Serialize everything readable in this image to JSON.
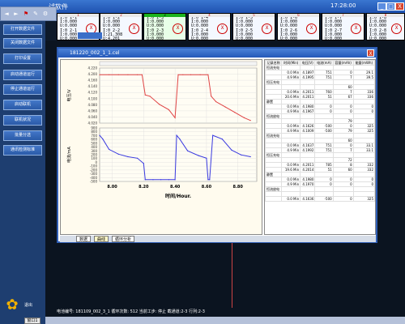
{
  "app": {
    "title": "试软件",
    "clock": "17:28:00"
  },
  "window_buttons": [
    "_",
    "□",
    "X"
  ],
  "toolbar": {
    "icons": [
      "◄",
      "►",
      "⚑",
      "✎",
      "⚙"
    ]
  },
  "channels": [
    {
      "num": "1",
      "lines": [
        "I:0 1-1",
        "I:0.000",
        "U:0.000",
        "T:0.000"
      ]
    },
    {
      "num": "2",
      "lines": [
        "I:0 1-2",
        "I:0.000",
        "U:0.000",
        "T:0.000"
      ]
    },
    {
      "num": "3",
      "lines": [
        "I:0 1-3",
        "I:0.000",
        "U:0.000",
        "T:0.000"
      ]
    },
    {
      "num": "4",
      "lines": [
        "I:0 1-4",
        "I:0.000",
        "U:0.000",
        "T:0.000"
      ]
    },
    {
      "num": "5",
      "lines": [
        "I:0 1-5",
        "I:0.000",
        "U:0.000",
        "T:0.000"
      ]
    },
    {
      "num": "6",
      "lines": [
        "I:0 1-6",
        "I:0.000",
        "U:0.000",
        "T:0.000"
      ]
    },
    {
      "num": "7",
      "lines": [
        "I:0 1-7",
        "I:0.000",
        "U:0.000",
        "T:0.000"
      ]
    },
    {
      "num": "8",
      "lines": [
        "I:0 1-8",
        "I:0.000",
        "U:0.000",
        "T:0.000"
      ]
    }
  ],
  "channels_row2": [
    {
      "lines": [
        "I:0 2-1",
        "I:0.000",
        "U:0.000",
        "T:0.000"
      ]
    },
    {
      "lines": [
        "I:0 2-2",
        "I:21.308",
        "U:4.201",
        "T:0.000"
      ]
    },
    {
      "lines": [
        "I:0 2-3",
        "I:0.000",
        "U:0.000",
        "T:0.000"
      ]
    },
    {
      "lines": [
        "I:0 2-4",
        "I:0.000",
        "U:0.000",
        "T:0.000"
      ]
    },
    {
      "lines": [
        "I:0 2-5",
        "I:0.000",
        "U:0.000",
        "T:0.000"
      ]
    },
    {
      "lines": [
        "I:0 2-6",
        "I:0.000",
        "U:0.000",
        "T:0.000"
      ]
    },
    {
      "lines": [
        "I:0 2-7",
        "I:0.000",
        "U:0.000",
        "T:0.000"
      ]
    },
    {
      "lines": [
        "I:0 2-8",
        "I:0.000",
        "U:0.000",
        "T:0.000"
      ]
    }
  ],
  "sidebar": {
    "items": [
      "打开数据文件",
      "关闭数据文件",
      "打印设置",
      "启动通道运行",
      "停止通道运行",
      "启动联机",
      "联机状况",
      "批量分选",
      "通讯检测标准"
    ],
    "exit_label": "退出"
  },
  "dialog": {
    "title": "181220_002_1_1.cel",
    "close": "X"
  },
  "chart_data": [
    {
      "type": "line",
      "title": "",
      "xlabel": "",
      "ylabel": "电压/V",
      "x": [
        7.92,
        7.98,
        8.04,
        8.1,
        8.16,
        8.19,
        8.21,
        8.24,
        8.3,
        8.36,
        8.4,
        8.42,
        8.45,
        8.5,
        8.56,
        8.61,
        8.63,
        8.66,
        8.72,
        8.78,
        8.84,
        8.88
      ],
      "values": [
        4.2,
        4.2,
        4.2,
        4.2,
        4.2,
        4.2,
        4.125,
        4.12,
        4.09,
        4.07,
        4.04,
        4.2,
        4.2,
        4.2,
        4.2,
        4.2,
        4.12,
        4.1,
        4.08,
        4.06,
        4.04,
        4.03
      ],
      "ylim": [
        4.02,
        4.225
      ],
      "yticks": [
        "4.220",
        "4.200",
        "4.160",
        "4.140",
        "4.120",
        "4.100",
        "4.080",
        "4.060",
        "4.040",
        "4.020"
      ],
      "grid": true
    },
    {
      "type": "line",
      "title": "",
      "xlabel": "时间/Hour.",
      "ylabel": "电流/mA",
      "x": [
        7.92,
        7.94,
        7.98,
        8.04,
        8.1,
        8.16,
        8.2,
        8.21,
        8.26,
        8.31,
        8.36,
        8.4,
        8.41,
        8.43,
        8.48,
        8.55,
        8.6,
        8.61,
        8.62,
        8.64,
        8.7,
        8.76,
        8.82,
        8.88
      ],
      "values": [
        700,
        600,
        320,
        190,
        120,
        80,
        -60,
        -500,
        -500,
        -500,
        -500,
        -500,
        700,
        600,
        280,
        150,
        80,
        -500,
        -500,
        700,
        600,
        300,
        170,
        120
      ],
      "ylim": [
        -550,
        900
      ],
      "yticks": [
        "900",
        "800",
        "700",
        "600",
        "500",
        "400",
        "300",
        "200",
        "100",
        "0",
        "-100",
        "-200",
        "-300",
        "-400",
        "-500"
      ],
      "xticks": [
        "8.00",
        "8.20",
        "8.40",
        "8.60",
        "8.80",
        "9.00"
      ],
      "grid": true
    }
  ],
  "table": {
    "headers": [
      "记录名称",
      "时间(Min)",
      "电压(V)",
      "电流(mA)",
      "容量(mAh)",
      "能量(mWh)"
    ],
    "rows": [
      [
        "恒流充电",
        "",
        "",
        "",
        "",
        ""
      ],
      [
        "",
        "0.0 Min",
        "4.1897",
        "751",
        "0",
        "29.1"
      ],
      [
        "",
        "4.9 Min",
        "4.1995",
        "751",
        "7",
        "39.5"
      ],
      [
        "恒压充电",
        "",
        "",
        "",
        "",
        ""
      ],
      [
        "",
        "",
        "",
        "",
        "60",
        ""
      ],
      [
        "",
        "0.0 Min",
        "4.2011",
        "760",
        "7",
        "336"
      ],
      [
        "",
        "20.6 Min",
        "4.2011",
        "51",
        "67",
        "336"
      ],
      [
        "静置",
        "",
        "",
        "",
        "",
        ""
      ],
      [
        "",
        "0.0 Min",
        "4.1980",
        "0",
        "0",
        "0"
      ],
      [
        "",
        "4.9 Min",
        "4.1967",
        "0",
        "0",
        "0"
      ],
      [
        "恒流放电",
        "",
        "",
        "",
        "",
        ""
      ],
      [
        "",
        "",
        "",
        "",
        "79",
        ""
      ],
      [
        "",
        "0.0 Min",
        "4.1626",
        "-500",
        "0",
        "325"
      ],
      [
        "",
        "4.9 Min",
        "4.1009",
        "-500",
        "79",
        "325"
      ],
      [
        "恒流充电",
        "",
        "",
        "",
        "",
        ""
      ],
      [
        "",
        "",
        "",
        "",
        "60",
        ""
      ],
      [
        "",
        "0.0 Min",
        "4.1637",
        "751",
        "0",
        "33.1"
      ],
      [
        "",
        "4.9 Min",
        "4.1992",
        "751",
        "7",
        "33.1"
      ],
      [
        "恒压充电",
        "",
        "",
        "",
        "",
        ""
      ],
      [
        "",
        "",
        "",
        "",
        "72",
        ""
      ],
      [
        "",
        "0.0 Min",
        "4.2011",
        "785",
        "8",
        "332"
      ],
      [
        "",
        "19.6 Min",
        "4.2014",
        "51",
        "60",
        "332"
      ],
      [
        "静置",
        "",
        "",
        "",
        "",
        ""
      ],
      [
        "",
        "0.0 Min",
        "4.1980",
        "0",
        "0",
        "0"
      ],
      [
        "",
        "4.9 Min",
        "4.1970",
        "0",
        "0",
        "0"
      ],
      [
        "恒流放电",
        "",
        "",
        "",
        "",
        ""
      ],
      [
        "",
        "",
        "",
        "",
        "",
        ""
      ],
      [
        "",
        "0.0 Min",
        "4.1636",
        "-500",
        "0",
        "325"
      ]
    ]
  },
  "sheet_tabs": [
    "数据",
    "曲线",
    "循环分析"
  ],
  "status": {
    "text": "电池编号: 181109_002_3_1 循环次数: 512 当前工步: 停止 截通道:2-3 行列:2-3"
  },
  "bottom_tab": "窗口1",
  "colors": {
    "voltage": "#e04444",
    "current": "#3a3ae0",
    "accent": "#2458b8"
  }
}
